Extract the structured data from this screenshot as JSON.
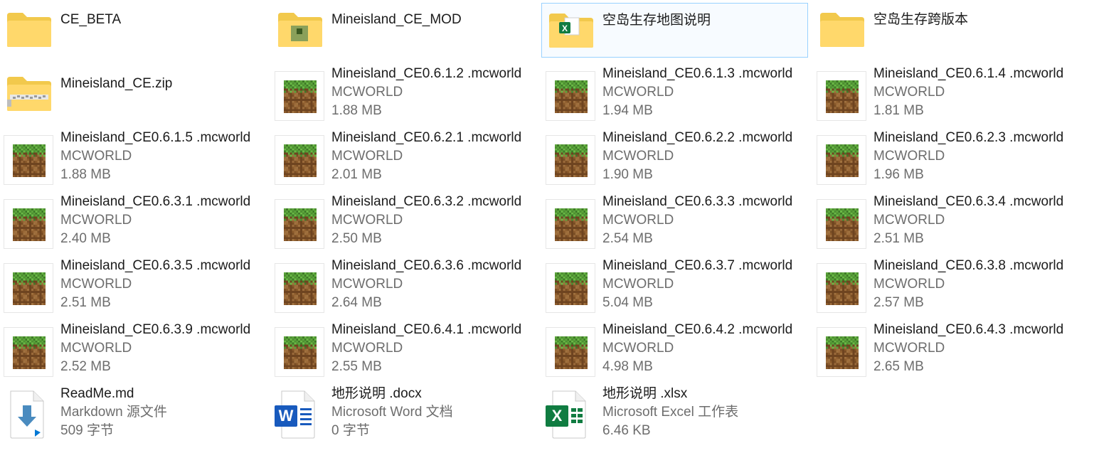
{
  "items": [
    {
      "name": "CE_BETA",
      "type": "folder"
    },
    {
      "name": "Mineisland_CE_MOD",
      "type": "folder-mod"
    },
    {
      "name": "空岛生存地图说明",
      "type": "folder-excel",
      "selected": true
    },
    {
      "name": "空岛生存跨版本",
      "type": "folder"
    },
    {
      "name": "Mineisland_CE.zip",
      "type": "zip"
    },
    {
      "name": "Mineisland_CE0.6.1.2 .mcworld",
      "kind": "MCWORLD",
      "size": "1.88 MB",
      "type": "mcworld"
    },
    {
      "name": "Mineisland_CE0.6.1.3 .mcworld",
      "kind": "MCWORLD",
      "size": "1.94 MB",
      "type": "mcworld"
    },
    {
      "name": "Mineisland_CE0.6.1.4 .mcworld",
      "kind": "MCWORLD",
      "size": "1.81 MB",
      "type": "mcworld"
    },
    {
      "name": "Mineisland_CE0.6.1.5 .mcworld",
      "kind": "MCWORLD",
      "size": "1.88 MB",
      "type": "mcworld"
    },
    {
      "name": "Mineisland_CE0.6.2.1 .mcworld",
      "kind": "MCWORLD",
      "size": "2.01 MB",
      "type": "mcworld"
    },
    {
      "name": "Mineisland_CE0.6.2.2 .mcworld",
      "kind": "MCWORLD",
      "size": "1.90 MB",
      "type": "mcworld"
    },
    {
      "name": "Mineisland_CE0.6.2.3 .mcworld",
      "kind": "MCWORLD",
      "size": "1.96 MB",
      "type": "mcworld"
    },
    {
      "name": "Mineisland_CE0.6.3.1 .mcworld",
      "kind": "MCWORLD",
      "size": "2.40 MB",
      "type": "mcworld"
    },
    {
      "name": "Mineisland_CE0.6.3.2 .mcworld",
      "kind": "MCWORLD",
      "size": "2.50 MB",
      "type": "mcworld"
    },
    {
      "name": "Mineisland_CE0.6.3.3 .mcworld",
      "kind": "MCWORLD",
      "size": "2.54 MB",
      "type": "mcworld"
    },
    {
      "name": "Mineisland_CE0.6.3.4 .mcworld",
      "kind": "MCWORLD",
      "size": "2.51 MB",
      "type": "mcworld"
    },
    {
      "name": "Mineisland_CE0.6.3.5 .mcworld",
      "kind": "MCWORLD",
      "size": "2.51 MB",
      "type": "mcworld"
    },
    {
      "name": "Mineisland_CE0.6.3.6 .mcworld",
      "kind": "MCWORLD",
      "size": "2.64 MB",
      "type": "mcworld"
    },
    {
      "name": "Mineisland_CE0.6.3.7 .mcworld",
      "kind": "MCWORLD",
      "size": "5.04 MB",
      "type": "mcworld"
    },
    {
      "name": "Mineisland_CE0.6.3.8 .mcworld",
      "kind": "MCWORLD",
      "size": "2.57 MB",
      "type": "mcworld"
    },
    {
      "name": "Mineisland_CE0.6.3.9 .mcworld",
      "kind": "MCWORLD",
      "size": "2.52 MB",
      "type": "mcworld"
    },
    {
      "name": "Mineisland_CE0.6.4.1 .mcworld",
      "kind": "MCWORLD",
      "size": "2.55 MB",
      "type": "mcworld"
    },
    {
      "name": "Mineisland_CE0.6.4.2 .mcworld",
      "kind": "MCWORLD",
      "size": "4.98 MB",
      "type": "mcworld"
    },
    {
      "name": "Mineisland_CE0.6.4.3 .mcworld",
      "kind": "MCWORLD",
      "size": "2.65 MB",
      "type": "mcworld"
    },
    {
      "name": "ReadMe.md",
      "kind": "Markdown 源文件",
      "size": "509 字节",
      "type": "markdown"
    },
    {
      "name": "地形说明 .docx",
      "kind": "Microsoft Word 文档",
      "size": "0 字节",
      "type": "word"
    },
    {
      "name": "地形说明 .xlsx",
      "kind": "Microsoft Excel 工作表",
      "size": "6.46 KB",
      "type": "excel"
    }
  ],
  "colors": {
    "folder_back": "#f2c94c",
    "folder_front": "#ffd86b",
    "selection_border": "#99d1ff",
    "word_blue": "#185abd",
    "excel_green": "#107c41",
    "vscode_blue": "#0078d4",
    "grass": "#5ba33b",
    "dirt": "#8b5a2b"
  }
}
